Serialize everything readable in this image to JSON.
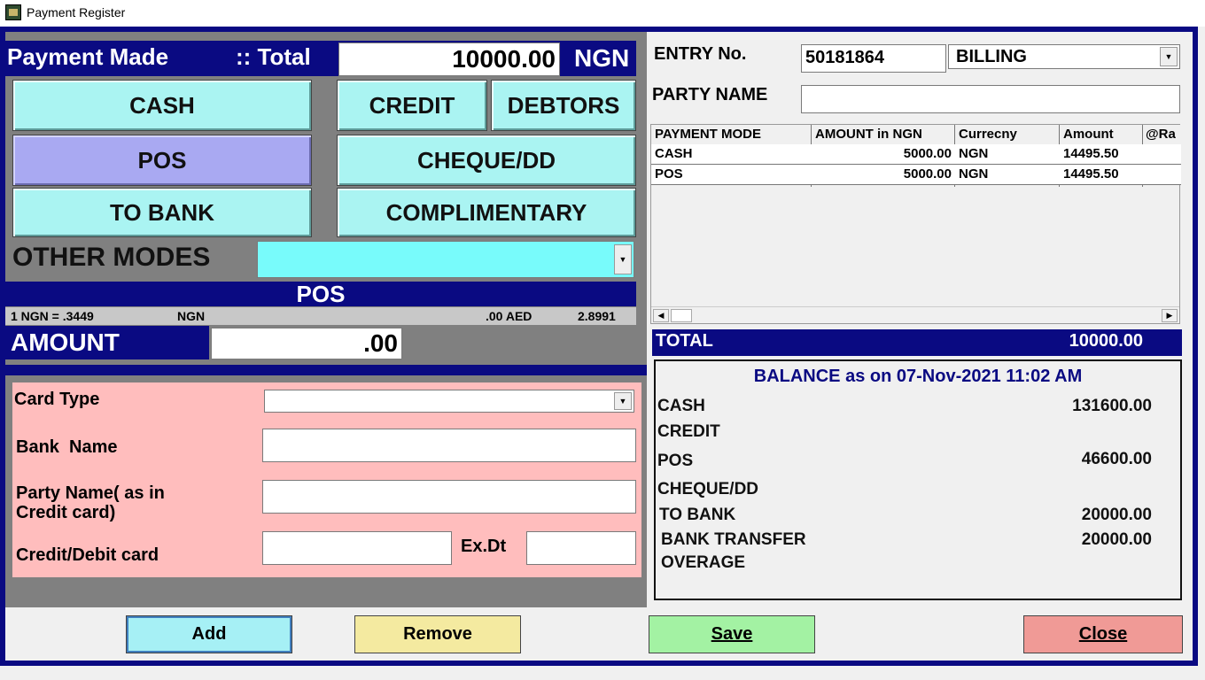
{
  "window": {
    "title": "Payment Register"
  },
  "header": {
    "label": "Payment Made",
    "total_label": ":: Total",
    "total_value": "10000.00",
    "currency": "NGN"
  },
  "modes": {
    "cash": "CASH",
    "credit": "CREDIT",
    "debtors": "DEBTORS",
    "pos": "POS",
    "cheque": "CHEQUE/DD",
    "to_bank": "TO BANK",
    "complimentary": "COMPLIMENTARY",
    "other_label": "OTHER MODES",
    "other_value": ""
  },
  "section": {
    "title": "POS"
  },
  "rate": {
    "left": "1  NGN =  .3449",
    "left_cur": "NGN",
    "right_amt": ".00 AED",
    "right_rate": "2.8991"
  },
  "amount": {
    "label": "AMOUNT",
    "value": ".00"
  },
  "card_form": {
    "card_type_label": "Card Type",
    "card_type_value": "",
    "bank_name_label": "Bank  Name",
    "bank_name_value": "",
    "party_name_label_1": "Party Name( as in",
    "party_name_label_2": "Credit card)",
    "party_name_value": "",
    "card_no_label": "Credit/Debit card",
    "card_no_value": "",
    "expiry_label": "Ex.Dt",
    "expiry_value": ""
  },
  "entry": {
    "label": "ENTRY No.",
    "value": "50181864",
    "type": "BILLING"
  },
  "party": {
    "label": "PARTY NAME",
    "value": ""
  },
  "grid": {
    "headers": [
      "PAYMENT MODE",
      "AMOUNT in NGN",
      "Currecny",
      "Amount",
      "@Ra"
    ],
    "rows": [
      [
        "CASH",
        "5000.00",
        "NGN",
        "14495.50"
      ],
      [
        "POS",
        "5000.00",
        "NGN",
        "14495.50"
      ]
    ]
  },
  "total": {
    "label": "TOTAL",
    "value": "10000.00"
  },
  "balance": {
    "title": "BALANCE as on 07-Nov-2021 11:02 AM",
    "items": [
      {
        "label": "CASH",
        "value": "131600.00"
      },
      {
        "label": "CREDIT",
        "value": ""
      },
      {
        "label": "POS",
        "value": "46600.00"
      },
      {
        "label": "CHEQUE/DD",
        "value": ""
      },
      {
        "label": "TO BANK",
        "value": "20000.00"
      },
      {
        "label": "BANK TRANSFER",
        "value": "20000.00"
      },
      {
        "label": "OVERAGE",
        "value": ""
      }
    ]
  },
  "buttons": {
    "add": "Add",
    "remove": "Remove",
    "save": "Save",
    "close": "Close"
  },
  "colors": {
    "navy": "#0a0a82",
    "cyan_btn": "#aaf4f2",
    "selected_btn": "#a9a9f2",
    "form_pink": "#ffbdbd",
    "add": "#a6f0f5",
    "remove": "#f4eaa0",
    "save": "#a3f2a3",
    "close": "#f09a96"
  }
}
